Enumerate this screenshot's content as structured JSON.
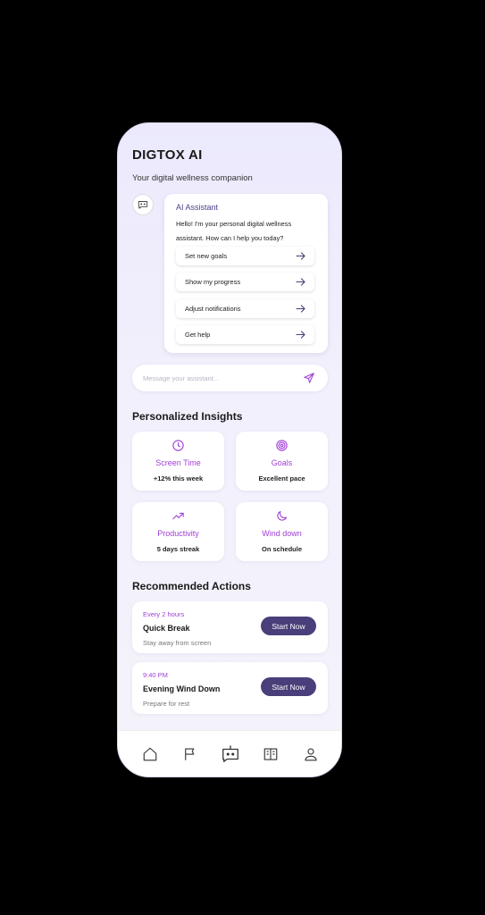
{
  "header": {
    "title": "DIGTOX AI",
    "subtitle": "Your digital wellness companion"
  },
  "assistant": {
    "name": "AI Assistant",
    "message": "Hello! I'm your personal digital wellness assistant. How can I help you today?",
    "options": [
      {
        "label": "Set new goals",
        "icon": "arrow-right-icon"
      },
      {
        "label": "Show my progress",
        "icon": "arrow-right-icon"
      },
      {
        "label": "Adjust notifications",
        "icon": "arrow-right-icon"
      },
      {
        "label": "Get help",
        "icon": "arrow-right-icon"
      }
    ]
  },
  "message_bar": {
    "placeholder": "Message your assistant...",
    "send_icon": "send-icon"
  },
  "insights": {
    "title": "Personalized Insights",
    "cards": [
      {
        "title": "Screen Time",
        "value": "+12% this week",
        "icon": "clock-icon"
      },
      {
        "title": "Goals",
        "value": "Excellent pace",
        "icon": "target-icon"
      },
      {
        "title": "Productivity",
        "value": "5 days streak",
        "icon": "trending-up-icon"
      },
      {
        "title": "Wind down",
        "value": "On schedule",
        "icon": "moon-icon"
      }
    ]
  },
  "actions": {
    "title": "Recommended Actions",
    "items": [
      {
        "when": "Every 2 hours",
        "name": "Quick Break",
        "desc": "Stay away from screen",
        "button": "Start Now"
      },
      {
        "when": "9:40 PM",
        "name": "Evening Wind Down",
        "desc": "Prepare for rest",
        "button": "Start Now"
      }
    ]
  },
  "nav": {
    "items": [
      "home-icon",
      "flag-icon",
      "bot-icon",
      "journal-icon",
      "profile-icon"
    ]
  },
  "colors": {
    "accent": "#a13fd6",
    "primary_dark": "#4a3f7a",
    "background": "#ece9fd"
  }
}
